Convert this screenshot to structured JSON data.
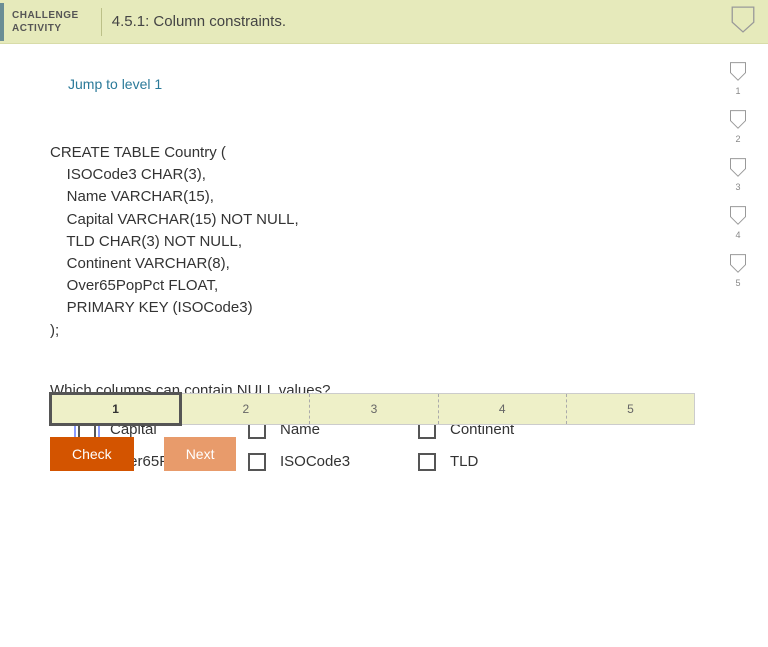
{
  "header": {
    "label_line1": "CHALLENGE",
    "label_line2": "ACTIVITY",
    "title": "4.5.1: Column constraints."
  },
  "jump_link": "Jump to level 1",
  "code": "CREATE TABLE Country (\n    ISOCode3 CHAR(3),\n    Name VARCHAR(15),\n    Capital VARCHAR(15) NOT NULL,\n    TLD CHAR(3) NOT NULL,\n    Continent VARCHAR(8),\n    Over65PopPct FLOAT,\n    PRIMARY KEY (ISOCode3)\n);",
  "question": "Which columns can contain NULL values?",
  "options": [
    {
      "label": "Capital",
      "focused": true
    },
    {
      "label": "Name",
      "focused": false
    },
    {
      "label": "Continent",
      "focused": false
    },
    {
      "label": "Over65PopPct",
      "focused": false
    },
    {
      "label": "ISOCode3",
      "focused": false
    },
    {
      "label": "TLD",
      "focused": false
    }
  ],
  "side_levels": [
    "1",
    "2",
    "3",
    "4",
    "5"
  ],
  "progress_segments": [
    "1",
    "2",
    "3",
    "4",
    "5"
  ],
  "progress_active": 0,
  "buttons": {
    "check": "Check",
    "next": "Next"
  }
}
